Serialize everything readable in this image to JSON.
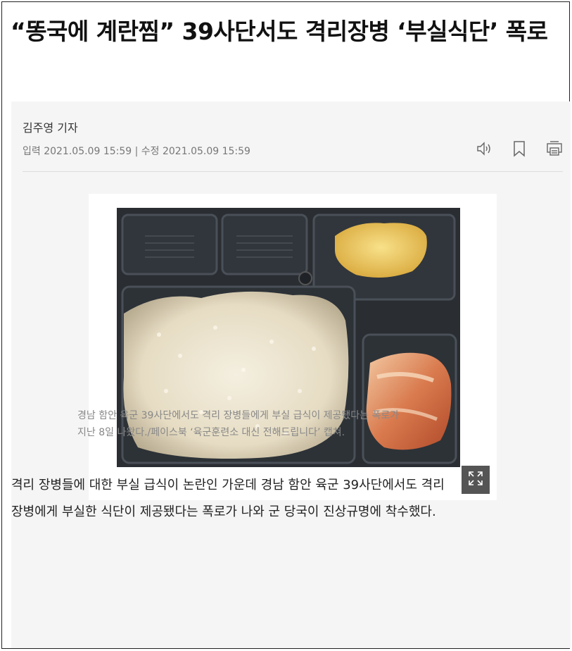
{
  "article": {
    "headline": "“똥국에 계란찜” 39사단서도 격리장병 ‘부실식단’ 폭로",
    "byline": "김주영 기자",
    "dateline": "입력 2021.05.09 15:59 | 수정 2021.05.09 15:59",
    "tools": {
      "listen_icon": "speaker-icon",
      "bookmark_icon": "bookmark-icon",
      "print_icon": "print-icon"
    },
    "photo": {
      "expand_icon": "expand-icon"
    },
    "caption_line1": "경남 함안 육군 39사단에서도 격리 장병들에게 부실 급식이 제공됐다는 폭로가",
    "caption_line2": "지난 8일 나왔다./페이스북 ‘육군훈련소 대신 전해드립니다’ 캡쳐.",
    "paragraph_line1": "격리 장병들에 대한 부실 급식이 논란인 가운데 경남 함안 육군 39사단에서도 격리",
    "paragraph_line2": "장병에게 부실한 식단이 제공됐다는 폭로가 나와 군 당국이 진상규명에 착수했다."
  }
}
